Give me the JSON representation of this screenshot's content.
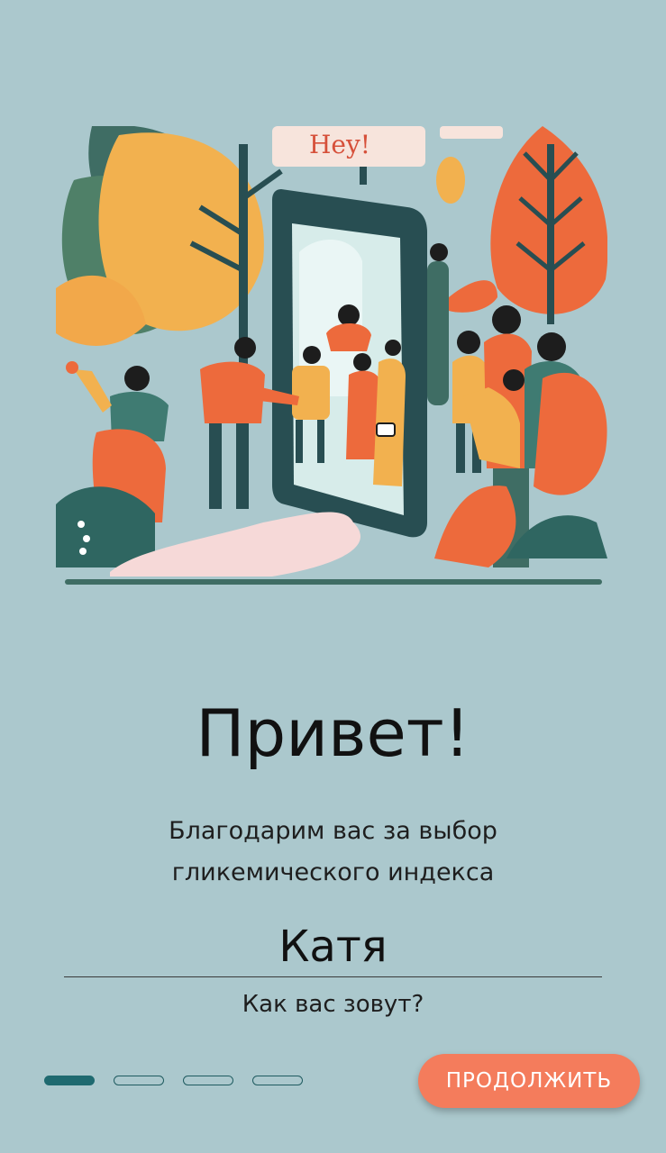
{
  "hero": {
    "sign_text": "Hey!"
  },
  "greeting": {
    "title": "Привет!",
    "subtitle_line1": "Благодарим вас за выбор",
    "subtitle_line2": "гликемического индекса"
  },
  "name_field": {
    "value": "Катя",
    "label": "Как вас зовут?"
  },
  "pagination": {
    "total": 4,
    "active_index": 0
  },
  "actions": {
    "continue_label": "ПРОДОЛЖИТЬ"
  },
  "colors": {
    "background": "#abc8cd",
    "accent": "#f47c5c",
    "dot_active": "#1f6a70"
  }
}
